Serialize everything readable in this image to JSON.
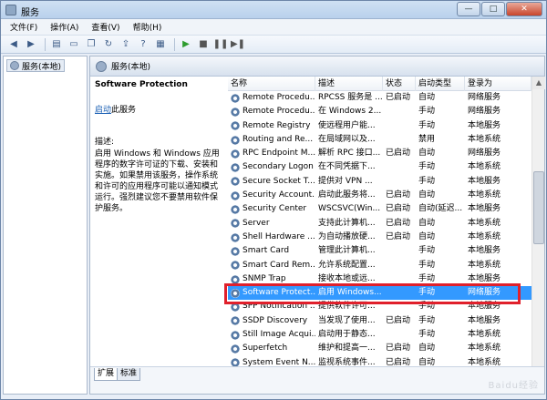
{
  "window": {
    "title": "服务",
    "min_label": "—",
    "max_label": "□",
    "close_label": "✕"
  },
  "menu": [
    "文件(F)",
    "操作(A)",
    "查看(V)",
    "帮助(H)"
  ],
  "tree": {
    "item": "服务(本地)"
  },
  "pane": {
    "title": "服务(本地)"
  },
  "detail": {
    "service_name": "Software Protection",
    "action_link": "启动",
    "action_suffix": "此服务",
    "desc_label": "描述:",
    "desc_text": "启用 Windows 和 Windows 应用程序的数字许可证的下载、安装和实施。如果禁用该服务，操作系统和许可的应用程序可能以通知模式运行。强烈建议您不要禁用软件保护服务。"
  },
  "table": {
    "columns": [
      "名称",
      "描述",
      "状态",
      "启动类型",
      "登录为"
    ],
    "rows": [
      [
        "Remote Procedu...",
        "RPCSS 服务是 ...",
        "已启动",
        "自动",
        "网络服务"
      ],
      [
        "Remote Procedu...",
        "在 Windows 2...",
        "",
        "手动",
        "网络服务"
      ],
      [
        "Remote Registry",
        "使远程用户能...",
        "",
        "手动",
        "本地服务"
      ],
      [
        "Routing and Re...",
        "在局域网以及...",
        "",
        "禁用",
        "本地系统"
      ],
      [
        "RPC Endpoint M...",
        "解析 RPC 接口...",
        "已启动",
        "自动",
        "网络服务"
      ],
      [
        "Secondary Logon",
        "在不同凭据下...",
        "",
        "手动",
        "本地系统"
      ],
      [
        "Secure Socket T...",
        "提供对 VPN ...",
        "",
        "手动",
        "本地服务"
      ],
      [
        "Security Account...",
        "启动此服务将...",
        "已启动",
        "自动",
        "本地系统"
      ],
      [
        "Security Center",
        "WSCSVC(Win...",
        "已启动",
        "自动(延迟...",
        "本地服务"
      ],
      [
        "Server",
        "支持此计算机...",
        "已启动",
        "自动",
        "本地系统"
      ],
      [
        "Shell Hardware ...",
        "为自动播放硬...",
        "已启动",
        "自动",
        "本地系统"
      ],
      [
        "Smart Card",
        "管理此计算机...",
        "",
        "手动",
        "本地服务"
      ],
      [
        "Smart Card Rem...",
        "允许系统配置...",
        "",
        "手动",
        "本地系统"
      ],
      [
        "SNMP Trap",
        "接收本地或远...",
        "",
        "手动",
        "本地服务"
      ],
      [
        "Software Protect...",
        "启用 Windows...",
        "",
        "手动",
        "网络服务"
      ],
      [
        "SPP Notification ...",
        "提供软件许可...",
        "",
        "手动",
        "本地服务"
      ],
      [
        "SSDP Discovery",
        "当发现了使用...",
        "已启动",
        "手动",
        "本地服务"
      ],
      [
        "Still Image Acqui...",
        "启动用于静态...",
        "",
        "手动",
        "本地系统"
      ],
      [
        "Superfetch",
        "维护和提高一...",
        "已启动",
        "自动",
        "本地系统"
      ],
      [
        "System Event N...",
        "监视系统事件...",
        "已启动",
        "自动",
        "本地系统"
      ]
    ],
    "selected_index": 14
  },
  "tabs": [
    "扩展",
    "标准"
  ],
  "watermark": "Baidu经验"
}
